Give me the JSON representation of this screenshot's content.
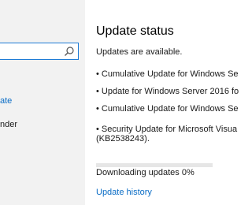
{
  "sidebar": {
    "search": {
      "value": "",
      "placeholder": ""
    },
    "items": [
      {
        "label": "ate"
      },
      {
        "label": "nder"
      }
    ]
  },
  "main": {
    "title": "Update status",
    "status": "Updates are available.",
    "updates": [
      "• Cumulative Update for Windows Se",
      "• Update for Windows Server 2016 fo",
      "• Cumulative Update for Windows Se",
      "• Security Update for Microsoft Visua",
      "(KB2538243)."
    ],
    "download_text": "Downloading updates 0%",
    "download_progress": 0,
    "history_link": "Update history"
  },
  "colors": {
    "accent": "#0b6dc6",
    "sidebar_bg": "#f2f2f2",
    "search_border": "#1e7bd6"
  },
  "icons": {
    "search": "search-icon"
  }
}
